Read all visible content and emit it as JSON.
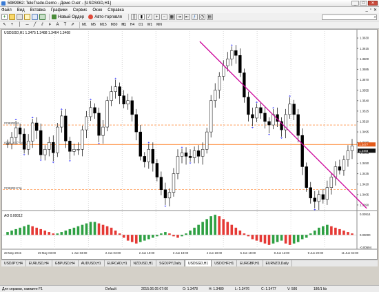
{
  "window": {
    "title": "5989962: TeleTrade-Demo - Демо Счет - [USDSGD,H1]",
    "minimize": "_",
    "maximize": "□",
    "close": "✕"
  },
  "menu": {
    "items": [
      "Файл",
      "Вид",
      "Вставка",
      "Графики",
      "Сервис",
      "Окно",
      "Справка"
    ],
    "mdi_controls": [
      "_",
      "▫",
      "✕"
    ]
  },
  "toolbar": {
    "new_order": "Новый Ордер",
    "auto_trading": "Авто-торговля",
    "search_placeholder": "",
    "icons": [
      "new-chart-icon",
      "profiles-icon",
      "market-watch-icon",
      "navigator-icon",
      "terminal-icon",
      "tester-icon",
      "new-order-icon",
      "auto-trading-icon",
      "bar-chart-icon",
      "candles-icon",
      "line-chart-icon",
      "zoom-in-icon",
      "zoom-out-icon",
      "tile-icon",
      "scroll-icon",
      "shift-icon",
      "indicators-icon",
      "periods-icon",
      "templates-icon"
    ]
  },
  "timeframes": [
    "M1",
    "M5",
    "M15",
    "M30",
    "H1",
    "H4",
    "D1",
    "W1",
    "MN"
  ],
  "drawing_tools": [
    "cursor-icon",
    "crosshair-icon",
    "vertical-line-icon",
    "horizontal-line-icon",
    "trendline-icon",
    "channel-icon",
    "fibonacci-icon",
    "text-icon",
    "label-icon",
    "arrows-icon"
  ],
  "chart": {
    "header": "USDSGD,H1  1.3475 1.3488 1.3464 1.3468",
    "indicator_label": "AO 0.00012",
    "y_ticks": [
      "1.3630",
      "1.3615",
      "1.3600",
      "1.3585",
      "1.3570",
      "1.3555",
      "1.3540",
      "1.3525",
      "1.3510",
      "1.3495",
      "1.3480",
      "1.3465",
      "1.3450",
      "1.3435",
      "1.3420",
      "1.3405",
      "1.3390"
    ],
    "x_ticks": [
      "28 May 2015",
      "28 May 16:00",
      "29 May 03:00",
      "29 May 11:00",
      "1 Jun 03:00",
      "1 Jun 19:00",
      "2 Jun 03:00",
      "2 Jun 11:00",
      "2 Jun 19:00",
      "3 Jun 11:00",
      "3 Jun 19:00",
      "4 Jun 11:00",
      "4 Jun 19:00",
      "5 Jun 11:00",
      "5 Jun 19:00",
      "8 Jun 03:00",
      "8 Jun 12:00",
      "9 Jun 12:00",
      "9 Jun 20:00",
      "10 Jun 12:00",
      "11 Jun 04:00"
    ],
    "hline_labels": [
      "#74820214",
      "#74820217 sell 0.10",
      "#74820217 tp"
    ],
    "bid_price": "1.3477",
    "ask_price": "1.3468",
    "ao_scale": [
      "0.00914",
      "0.00000",
      "-0.00694"
    ],
    "colors": {
      "candle": "#000000",
      "trendline": "#cc0099",
      "order_line": "#ff6a00",
      "tp_line": "#ff6a00",
      "ao_up": "#2ea043",
      "ao_down": "#e53935",
      "fractal": "#4a4aff"
    }
  },
  "chart_data": {
    "type": "candlestick",
    "symbol": "USDSGD",
    "timeframe": "H1",
    "title": "USDSGD,H1",
    "ylim": [
      1.338,
      1.364
    ],
    "close": [
      1.3478,
      1.3487,
      1.3501,
      1.3492,
      1.347,
      1.3482,
      1.3508,
      1.3497,
      1.3462,
      1.347,
      1.348,
      1.3465,
      1.3502,
      1.3518,
      1.3482,
      1.3467,
      1.347,
      1.347,
      1.3498,
      1.3517,
      1.353,
      1.3522,
      1.349,
      1.3502,
      1.354,
      1.3553,
      1.356,
      1.3547,
      1.3535,
      1.354,
      1.352,
      1.3495,
      1.346,
      1.3452,
      1.347,
      1.345,
      1.343,
      1.3412,
      1.34,
      1.3408,
      1.3435,
      1.346,
      1.3465,
      1.346,
      1.3458,
      1.3468,
      1.346,
      1.347,
      1.3495,
      1.354,
      1.3555,
      1.3575,
      1.359,
      1.36,
      1.3612,
      1.3605,
      1.358,
      1.3545,
      1.352,
      1.3515,
      1.353,
      1.3522,
      1.351,
      1.3505,
      1.352,
      1.351,
      1.3498,
      1.352,
      1.3535,
      1.352,
      1.349,
      1.3445,
      1.3415,
      1.34,
      1.3395,
      1.3405,
      1.3398,
      1.3415,
      1.343,
      1.3445,
      1.344,
      1.3455,
      1.3468,
      1.3475
    ],
    "trendline": {
      "x": [
        "3 Jun 19:00",
        "11 Jun 04:00"
      ],
      "y": [
        1.3625,
        1.3385
      ]
    },
    "order_lines": [
      1.3505,
      1.3477,
      1.3412
    ],
    "ao": {
      "name": "AO",
      "values": [
        0.0002,
        0.0003,
        0.0004,
        0.0005,
        0.0006,
        0.0007,
        0.0006,
        0.0005,
        0.0004,
        0.0003,
        0.0002,
        0.0001,
        0.0001,
        0.0002,
        0.0003,
        0.0004,
        0.0005,
        0.0006,
        0.0007,
        0.0008,
        0.0009,
        0.0009,
        0.0008,
        0.0007,
        0.0006,
        0.0005,
        0.0003,
        0.0001,
        -0.0002,
        -0.0004,
        -0.0005,
        -0.0006,
        -0.0005,
        -0.0004,
        -0.0003,
        -0.0002,
        -0.0001,
        0.0001,
        0.0002,
        0.0001,
        -0.0001,
        -0.0002,
        -0.0001,
        0.0001,
        0.0003,
        0.0005,
        0.0007,
        0.0009,
        0.0011,
        0.0013,
        0.0014,
        0.0013,
        0.0011,
        0.0009,
        0.0007,
        0.0005,
        0.0003,
        0.0001,
        -0.0001,
        -0.0003,
        -0.0004,
        -0.0005,
        -0.0006,
        -0.0007,
        -0.0006,
        -0.0005,
        -0.0004,
        -0.0006,
        -0.0007,
        -0.0006,
        -0.0005,
        -0.0003,
        -0.0002,
        0.0001,
        0.0003,
        0.0005,
        0.0006,
        0.0007,
        0.0006,
        0.0005,
        0.0004,
        0.0003,
        0.0002,
        0.0001
      ]
    }
  },
  "tabs": [
    {
      "label": "USDJPY,H4",
      "active": false
    },
    {
      "label": "EURUSD,H4",
      "active": false
    },
    {
      "label": "GBPUSD,H4",
      "active": false
    },
    {
      "label": "AUDUSD,H1",
      "active": false
    },
    {
      "label": "EURCAD,H1",
      "active": false
    },
    {
      "label": "NZDUSD,H1",
      "active": false
    },
    {
      "label": "SGDJPY,Daily",
      "active": false
    },
    {
      "label": "USDSGD,H1",
      "active": true
    },
    {
      "label": "USDCHF,H1",
      "active": false
    },
    {
      "label": "EURGBP,H1",
      "active": false
    },
    {
      "label": "EURNZD,Daily",
      "active": false
    }
  ],
  "status": {
    "help": "Для справки, нажмите F1",
    "profile": "Default",
    "datetime": "2015.06.05 07:00",
    "open": "O: 1.3478",
    "high": "H: 1.3480",
    "low": "L: 1.3476",
    "close": "C: 1.3477",
    "volume": "V: 586",
    "traffic": "180/1 kb"
  }
}
